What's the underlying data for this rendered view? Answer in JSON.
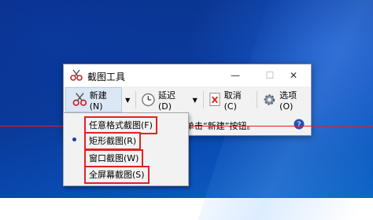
{
  "window": {
    "title": "截图工具",
    "minimize_glyph": "—",
    "maximize_glyph": "☐",
    "close_glyph": "✕"
  },
  "toolbar": {
    "new_label": "新建(N)",
    "delay_label": "延迟(D)",
    "cancel_label": "取消(C)",
    "options_label": "选项(O)",
    "dropdown_glyph": "▼"
  },
  "message": {
    "text": "单击“新建”按钮。"
  },
  "snip_menu": {
    "selected_index": 1,
    "items": [
      {
        "label": "任意格式截图(F)"
      },
      {
        "label": "矩形截图(R)"
      },
      {
        "label": "窗口截图(W)"
      },
      {
        "label": "全屏幕截图(S)"
      }
    ]
  },
  "icons": {
    "app": "scissors-icon",
    "new": "scissors-icon",
    "delay": "clock-icon",
    "cancel": "cancel-icon",
    "options": "gear-icon",
    "help": "help-icon"
  },
  "colors": {
    "desktop": "#0a3a9a",
    "highlight_border": "#e02222",
    "guide_line": "#e52020"
  }
}
